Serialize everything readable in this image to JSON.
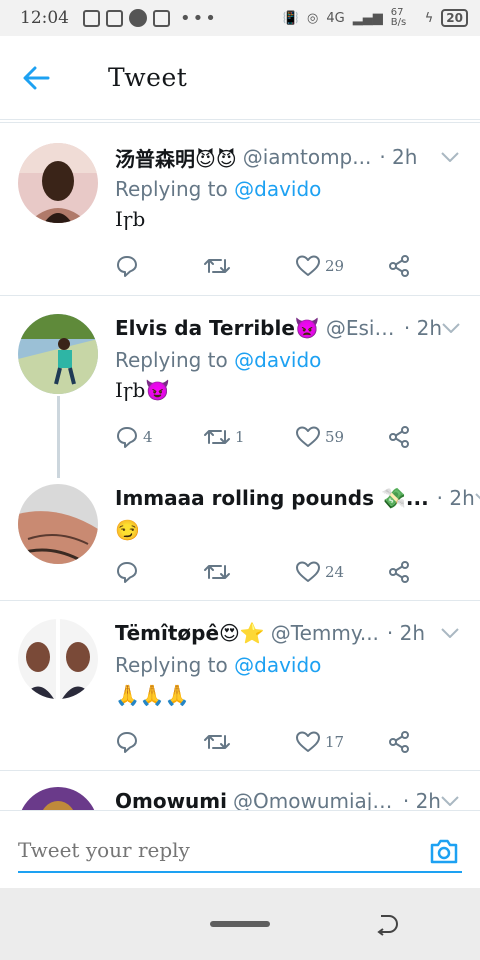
{
  "status_bar": {
    "time": "12:04",
    "speed": "67 B/s",
    "network": "4G",
    "battery": "20"
  },
  "header": {
    "title": "Tweet"
  },
  "tweets": [
    {
      "name": "汤普森明😈😈",
      "handle": "@iamtomp...",
      "time": "· 2h",
      "replying_label": "Replying to",
      "replying_to": "@davido",
      "text": "Iꞅb",
      "replies": "",
      "retweets": "",
      "likes": "29"
    },
    {
      "name": "Elvis da Terrible👿",
      "handle": "@Esik...",
      "time": "· 2h",
      "replying_label": "Replying to",
      "replying_to": "@davido",
      "text": "Iꞅb😈",
      "replies": "4",
      "retweets": "1",
      "likes": "59"
    },
    {
      "name": "Immaaa rolling pounds 💸...",
      "handle": "",
      "time": "· 2h",
      "text": "😏",
      "replies": "",
      "retweets": "",
      "likes": "24"
    },
    {
      "name": "Tëmîtøpê😍⭐",
      "handle": "@Temmy...",
      "time": "· 2h",
      "replying_label": "Replying to",
      "replying_to": "@davido",
      "text": "🙏🙏🙏",
      "replies": "",
      "retweets": "",
      "likes": "17"
    },
    {
      "name": "Omowumi",
      "handle": "@Omowumiajo...",
      "time": "· 2h"
    }
  ],
  "reply_bar": {
    "placeholder": "Tweet your reply"
  },
  "colors": {
    "accent": "#1da1f2",
    "muted": "#657786",
    "divider": "#e1e8ed"
  }
}
